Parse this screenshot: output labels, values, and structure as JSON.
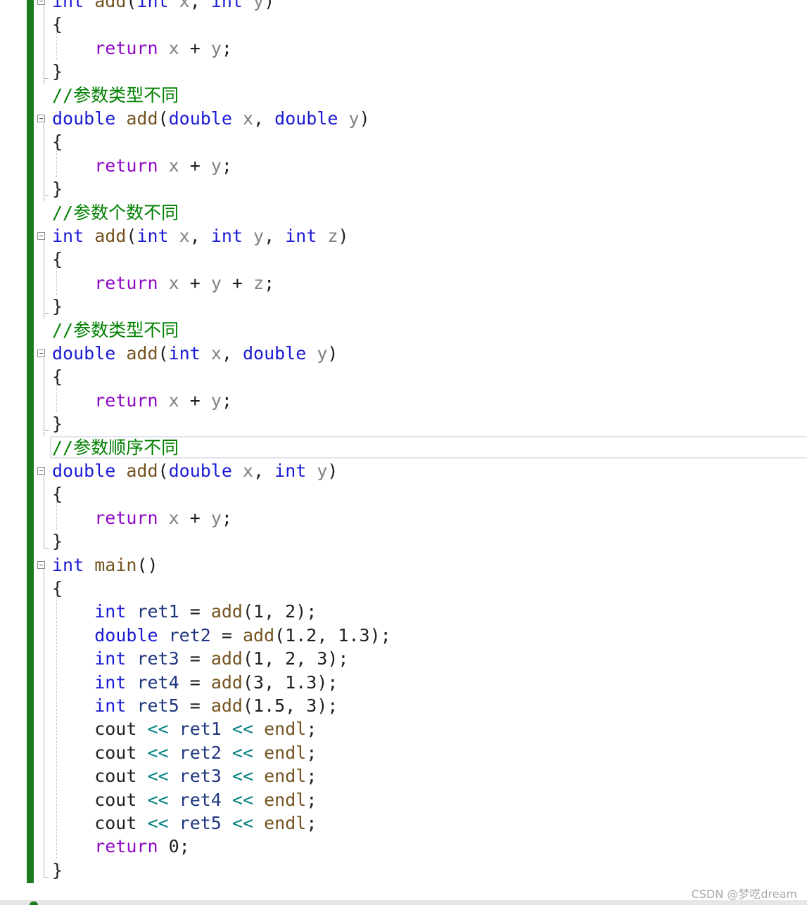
{
  "code": {
    "lines": [
      {
        "t": [
          [
            "kw",
            "int"
          ],
          [
            "n",
            " "
          ],
          [
            "fn",
            "add"
          ],
          [
            "n",
            "("
          ],
          [
            "kw",
            "int"
          ],
          [
            "n",
            " "
          ],
          [
            "pm",
            "x"
          ],
          [
            "n",
            ", "
          ],
          [
            "kw",
            "int"
          ],
          [
            "n",
            " "
          ],
          [
            "pm",
            "y"
          ],
          [
            "n",
            ")"
          ]
        ]
      },
      {
        "t": [
          [
            "n",
            "{"
          ]
        ]
      },
      {
        "t": [
          [
            "n",
            "    "
          ],
          [
            "rt",
            "return"
          ],
          [
            "n",
            " "
          ],
          [
            "pm",
            "x"
          ],
          [
            "n",
            " + "
          ],
          [
            "pm",
            "y"
          ],
          [
            "n",
            ";"
          ]
        ]
      },
      {
        "t": [
          [
            "n",
            "}"
          ]
        ]
      },
      {
        "t": [
          [
            "cm",
            "//参数类型不同"
          ]
        ]
      },
      {
        "t": [
          [
            "kw",
            "double"
          ],
          [
            "n",
            " "
          ],
          [
            "fn",
            "add"
          ],
          [
            "n",
            "("
          ],
          [
            "kw",
            "double"
          ],
          [
            "n",
            " "
          ],
          [
            "pm",
            "x"
          ],
          [
            "n",
            ", "
          ],
          [
            "kw",
            "double"
          ],
          [
            "n",
            " "
          ],
          [
            "pm",
            "y"
          ],
          [
            "n",
            ")"
          ]
        ]
      },
      {
        "t": [
          [
            "n",
            "{"
          ]
        ]
      },
      {
        "t": [
          [
            "n",
            "    "
          ],
          [
            "rt",
            "return"
          ],
          [
            "n",
            " "
          ],
          [
            "pm",
            "x"
          ],
          [
            "n",
            " + "
          ],
          [
            "pm",
            "y"
          ],
          [
            "n",
            ";"
          ]
        ]
      },
      {
        "t": [
          [
            "n",
            "}"
          ]
        ]
      },
      {
        "t": [
          [
            "cm",
            "//参数个数不同"
          ]
        ]
      },
      {
        "t": [
          [
            "kw",
            "int"
          ],
          [
            "n",
            " "
          ],
          [
            "fn",
            "add"
          ],
          [
            "n",
            "("
          ],
          [
            "kw",
            "int"
          ],
          [
            "n",
            " "
          ],
          [
            "pm",
            "x"
          ],
          [
            "n",
            ", "
          ],
          [
            "kw",
            "int"
          ],
          [
            "n",
            " "
          ],
          [
            "pm",
            "y"
          ],
          [
            "n",
            ", "
          ],
          [
            "kw",
            "int"
          ],
          [
            "n",
            " "
          ],
          [
            "pm",
            "z"
          ],
          [
            "n",
            ")"
          ]
        ]
      },
      {
        "t": [
          [
            "n",
            "{"
          ]
        ]
      },
      {
        "t": [
          [
            "n",
            "    "
          ],
          [
            "rt",
            "return"
          ],
          [
            "n",
            " "
          ],
          [
            "pm",
            "x"
          ],
          [
            "n",
            " + "
          ],
          [
            "pm",
            "y"
          ],
          [
            "n",
            " + "
          ],
          [
            "pm",
            "z"
          ],
          [
            "n",
            ";"
          ]
        ]
      },
      {
        "t": [
          [
            "n",
            "}"
          ]
        ]
      },
      {
        "t": [
          [
            "cm",
            "//参数类型不同"
          ]
        ]
      },
      {
        "t": [
          [
            "kw",
            "double"
          ],
          [
            "n",
            " "
          ],
          [
            "fn",
            "add"
          ],
          [
            "n",
            "("
          ],
          [
            "kw",
            "int"
          ],
          [
            "n",
            " "
          ],
          [
            "pm",
            "x"
          ],
          [
            "n",
            ", "
          ],
          [
            "kw",
            "double"
          ],
          [
            "n",
            " "
          ],
          [
            "pm",
            "y"
          ],
          [
            "n",
            ")"
          ]
        ]
      },
      {
        "t": [
          [
            "n",
            "{"
          ]
        ]
      },
      {
        "t": [
          [
            "n",
            "    "
          ],
          [
            "rt",
            "return"
          ],
          [
            "n",
            " "
          ],
          [
            "pm",
            "x"
          ],
          [
            "n",
            " + "
          ],
          [
            "pm",
            "y"
          ],
          [
            "n",
            ";"
          ]
        ]
      },
      {
        "t": [
          [
            "n",
            "}"
          ]
        ]
      },
      {
        "t": [
          [
            "cm",
            "//参数顺序不同"
          ]
        ]
      },
      {
        "t": [
          [
            "kw",
            "double"
          ],
          [
            "n",
            " "
          ],
          [
            "fn",
            "add"
          ],
          [
            "n",
            "("
          ],
          [
            "kw",
            "double"
          ],
          [
            "n",
            " "
          ],
          [
            "pm",
            "x"
          ],
          [
            "n",
            ", "
          ],
          [
            "kw",
            "int"
          ],
          [
            "n",
            " "
          ],
          [
            "pm",
            "y"
          ],
          [
            "n",
            ")"
          ]
        ]
      },
      {
        "t": [
          [
            "n",
            "{"
          ]
        ]
      },
      {
        "t": [
          [
            "n",
            "    "
          ],
          [
            "rt",
            "return"
          ],
          [
            "n",
            " "
          ],
          [
            "pm",
            "x"
          ],
          [
            "n",
            " + "
          ],
          [
            "pm",
            "y"
          ],
          [
            "n",
            ";"
          ]
        ]
      },
      {
        "t": [
          [
            "n",
            "}"
          ]
        ]
      },
      {
        "t": [
          [
            "kw",
            "int"
          ],
          [
            "n",
            " "
          ],
          [
            "fn",
            "main"
          ],
          [
            "n",
            "()"
          ]
        ]
      },
      {
        "t": [
          [
            "n",
            "{"
          ]
        ]
      },
      {
        "t": [
          [
            "n",
            "    "
          ],
          [
            "kw",
            "int"
          ],
          [
            "n",
            " "
          ],
          [
            "vr",
            "ret1"
          ],
          [
            "n",
            " = "
          ],
          [
            "fn",
            "add"
          ],
          [
            "n",
            "(1, 2);"
          ]
        ]
      },
      {
        "t": [
          [
            "n",
            "    "
          ],
          [
            "kw",
            "double"
          ],
          [
            "n",
            " "
          ],
          [
            "vr",
            "ret2"
          ],
          [
            "n",
            " = "
          ],
          [
            "fn",
            "add"
          ],
          [
            "n",
            "(1.2, 1.3);"
          ]
        ]
      },
      {
        "t": [
          [
            "n",
            "    "
          ],
          [
            "kw",
            "int"
          ],
          [
            "n",
            " "
          ],
          [
            "vr",
            "ret3"
          ],
          [
            "n",
            " = "
          ],
          [
            "fn",
            "add"
          ],
          [
            "n",
            "(1, 2, 3);"
          ]
        ]
      },
      {
        "t": [
          [
            "n",
            "    "
          ],
          [
            "kw",
            "int"
          ],
          [
            "n",
            " "
          ],
          [
            "vr",
            "ret4"
          ],
          [
            "n",
            " = "
          ],
          [
            "fn",
            "add"
          ],
          [
            "n",
            "(3, 1.3);"
          ]
        ]
      },
      {
        "t": [
          [
            "n",
            "    "
          ],
          [
            "kw",
            "int"
          ],
          [
            "n",
            " "
          ],
          [
            "vr",
            "ret5"
          ],
          [
            "n",
            " = "
          ],
          [
            "fn",
            "add"
          ],
          [
            "n",
            "(1.5, 3);"
          ]
        ]
      },
      {
        "t": [
          [
            "n",
            "    cout "
          ],
          [
            "op",
            "<<"
          ],
          [
            "n",
            " "
          ],
          [
            "vr",
            "ret1"
          ],
          [
            "n",
            " "
          ],
          [
            "op",
            "<<"
          ],
          [
            "n",
            " "
          ],
          [
            "fn",
            "endl"
          ],
          [
            "n",
            ";"
          ]
        ]
      },
      {
        "t": [
          [
            "n",
            "    cout "
          ],
          [
            "op",
            "<<"
          ],
          [
            "n",
            " "
          ],
          [
            "vr",
            "ret2"
          ],
          [
            "n",
            " "
          ],
          [
            "op",
            "<<"
          ],
          [
            "n",
            " "
          ],
          [
            "fn",
            "endl"
          ],
          [
            "n",
            ";"
          ]
        ]
      },
      {
        "t": [
          [
            "n",
            "    cout "
          ],
          [
            "op",
            "<<"
          ],
          [
            "n",
            " "
          ],
          [
            "vr",
            "ret3"
          ],
          [
            "n",
            " "
          ],
          [
            "op",
            "<<"
          ],
          [
            "n",
            " "
          ],
          [
            "fn",
            "endl"
          ],
          [
            "n",
            ";"
          ]
        ]
      },
      {
        "t": [
          [
            "n",
            "    cout "
          ],
          [
            "op",
            "<<"
          ],
          [
            "n",
            " "
          ],
          [
            "vr",
            "ret4"
          ],
          [
            "n",
            " "
          ],
          [
            "op",
            "<<"
          ],
          [
            "n",
            " "
          ],
          [
            "fn",
            "endl"
          ],
          [
            "n",
            ";"
          ]
        ]
      },
      {
        "t": [
          [
            "n",
            "    cout "
          ],
          [
            "op",
            "<<"
          ],
          [
            "n",
            " "
          ],
          [
            "vr",
            "ret5"
          ],
          [
            "n",
            " "
          ],
          [
            "op",
            "<<"
          ],
          [
            "n",
            " "
          ],
          [
            "fn",
            "endl"
          ],
          [
            "n",
            ";"
          ]
        ]
      },
      {
        "t": [
          [
            "n",
            "    "
          ],
          [
            "rt",
            "return"
          ],
          [
            "n",
            " 0;"
          ]
        ]
      },
      {
        "t": [
          [
            "n",
            "}"
          ]
        ]
      }
    ]
  },
  "watermark": "CSDN @梦呓dream",
  "colors": {
    "keyword": "#1a1ad6",
    "function": "#74531f",
    "parameter": "#808080",
    "return_keyword": "#8f08c4",
    "comment": "#008000",
    "variable": "#1f377f",
    "operator": "#008080",
    "change_bar": "#1e7a1e"
  }
}
